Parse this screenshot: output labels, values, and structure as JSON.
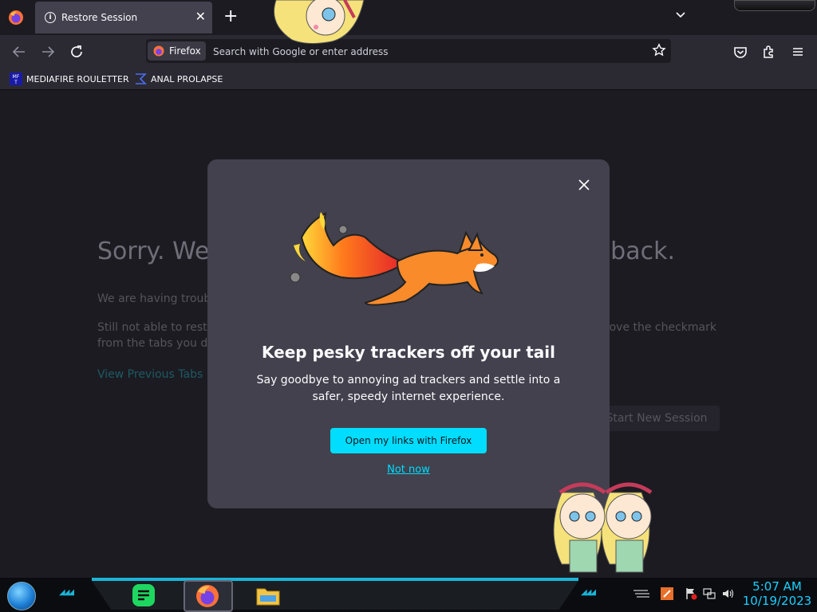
{
  "tab": {
    "title": "Restore Session"
  },
  "urlbar": {
    "identity_label": "Firefox",
    "placeholder": "Search with Google or enter address"
  },
  "bookmarks": [
    {
      "label": "MEDIAFIRE ROULETTER",
      "favicon_text": "MF T"
    },
    {
      "label": "ANAL PROLAPSE"
    }
  ],
  "page": {
    "heading_start": "Sorry. We’",
    "heading_end": "back.",
    "line1": "We are having troubl",
    "line2_start": "Still not able to resto",
    "line2_end": "move the checkmark",
    "line3": "from the tabs you do",
    "view_tabs": "View Previous Tabs",
    "start_new": "Start New Session"
  },
  "modal": {
    "title": "Keep pesky trackers off your tail",
    "description": "Say goodbye to annoying ad trackers and settle into a safer, speedy internet experience.",
    "primary_button": "Open my links with Firefox",
    "secondary_link": "Not now"
  },
  "taskbar": {
    "time": "5:07 AM",
    "date": "10/19/2023"
  },
  "colors": {
    "accent": "#00ddff",
    "modal_bg": "#42414d",
    "page_bg": "#1c1b22",
    "taskbar_glow": "#19b5d8"
  },
  "icons": [
    "firefox-icon",
    "info-icon",
    "close-icon",
    "plus-icon",
    "chevron-down-icon",
    "back-icon",
    "forward-icon",
    "reload-icon",
    "star-icon",
    "pocket-icon",
    "extensions-icon",
    "menu-icon",
    "fox-illustration",
    "start-orb-icon",
    "messages-icon",
    "file-explorer-icon"
  ]
}
